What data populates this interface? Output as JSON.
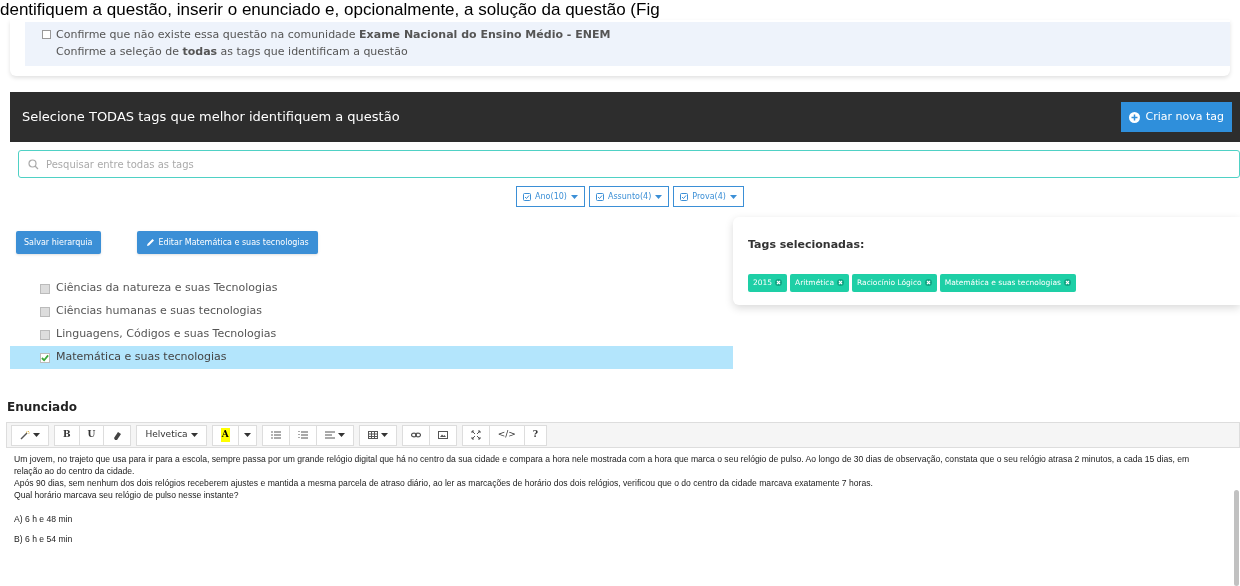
{
  "page_heading": "dentifiquem a questão, inserir o enunciado e, opcionalmente, a solução da questão (Fig",
  "notice": {
    "checked": false,
    "lines": [
      "Confirme que não existe essa questão na comunidade **Exame Nacional do Ensino Médio - ENEM**",
      "Confirme a seleção de **todas** as tags que identificam a questão"
    ]
  },
  "tag_panel": {
    "title": "Selecione TODAS tags que melhor identifiquem a questão",
    "new_tag_button": "Criar nova tag",
    "search": {
      "placeholder": "Pesquisar entre todas as tags"
    },
    "filters": [
      {
        "label": "Ano(10)"
      },
      {
        "label": "Assunto(4)"
      },
      {
        "label": "Prova(4)"
      }
    ],
    "save_button": "Salvar hierarquia",
    "edit_button": "Editar Matemática e suas tecnologias",
    "tree": [
      {
        "label": "Ciências da natureza e suas Tecnologias",
        "checked": false,
        "selected": false
      },
      {
        "label": "Ciências humanas e suas tecnologias",
        "checked": false,
        "selected": false
      },
      {
        "label": "Linguagens, Códigos e suas Tecnologias",
        "checked": false,
        "selected": false
      },
      {
        "label": "Matemática e suas tecnologias",
        "checked": true,
        "selected": true
      }
    ],
    "selected_tags": {
      "title": "Tags selecionadas:",
      "tags": [
        "2015",
        "Aritmética",
        "Raciocínio Lógico",
        "Matemática e suas tecnologias"
      ]
    }
  },
  "editor": {
    "title": "Enunciado",
    "toolbar": [
      [
        {
          "kind": "wand",
          "caret": true
        }
      ],
      [
        {
          "kind": "text",
          "label": "B",
          "caret": false
        },
        {
          "kind": "text",
          "label": "U",
          "caret": false
        },
        {
          "kind": "eraser",
          "caret": false
        }
      ],
      [
        {
          "kind": "text",
          "label": "Helvetica",
          "caret": true
        }
      ],
      [
        {
          "kind": "highlight",
          "label": "A",
          "caret": false
        },
        {
          "kind": "caret",
          "caret": true
        }
      ],
      [
        {
          "kind": "bullets",
          "caret": false
        },
        {
          "kind": "numbers",
          "caret": false
        },
        {
          "kind": "align",
          "caret": true
        }
      ],
      [
        {
          "kind": "table",
          "caret": true
        }
      ],
      [
        {
          "kind": "link",
          "caret": false
        },
        {
          "kind": "image",
          "caret": false
        }
      ],
      [
        {
          "kind": "expand",
          "caret": false
        },
        {
          "kind": "text",
          "label": "</>",
          "caret": false
        },
        {
          "kind": "text",
          "label": "?",
          "caret": false
        }
      ]
    ],
    "paragraphs": [
      "Um jovem, no trajeto que usa para ir para a escola, sempre passa por um grande relógio digital que há no centro da sua cidade e compara a hora nele mostrada com a hora que marca o seu relógio de pulso. Ao longo de 30 dias de observação, constata que o seu relógio atrasa 2 minutos, a cada 15 dias, em relação ao do centro da cidade.",
      "Após 90 dias, sem nenhum dos dois relógios receberem ajustes e mantida a mesma parcela de atraso diário, ao ler as marcações de horário dos dois relógios, verificou que o do centro da cidade marcava exatamente 7 horas.",
      "Qual horário marcava seu relógio de pulso nesse instante?"
    ],
    "options": [
      "A) 6 h e 48 min",
      "B) 6 h e 54 min"
    ]
  }
}
